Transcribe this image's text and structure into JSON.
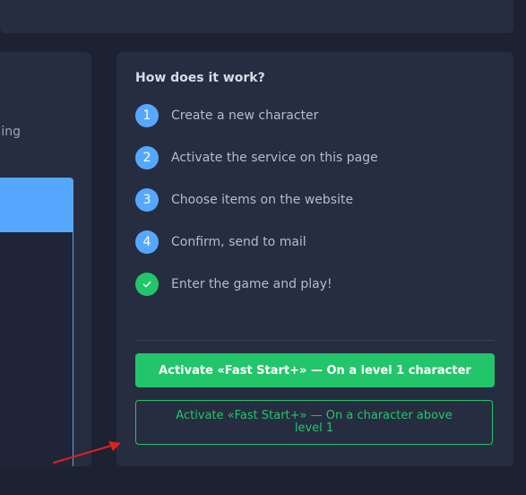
{
  "left": {
    "partial_text": "ing"
  },
  "how": {
    "title": "How does it work?",
    "steps": [
      {
        "num": "1",
        "label": "Create a new character"
      },
      {
        "num": "2",
        "label": "Activate the service on this page"
      },
      {
        "num": "3",
        "label": "Choose items on the website"
      },
      {
        "num": "4",
        "label": "Confirm, send to mail"
      },
      {
        "num": "",
        "icon": "check-icon",
        "label": "Enter the game and play!"
      }
    ]
  },
  "buttons": {
    "level1": "Activate «Fast Start+» — On a level 1 character",
    "above": "Activate «Fast Start+» — On a character above level 1"
  },
  "colors": {
    "accent_blue": "#56a8ff",
    "accent_green": "#22c56a",
    "annotation_arrow": "#e0201b"
  },
  "annotation": {
    "icon": "red-arrow-icon"
  }
}
